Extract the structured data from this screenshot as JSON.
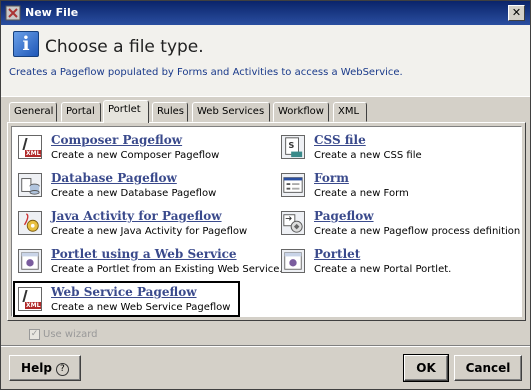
{
  "window": {
    "title": "New File"
  },
  "header": {
    "title": "Choose a file type.",
    "description": "Creates a Pageflow populated by Forms and Activities to access a WebService."
  },
  "tabs": [
    {
      "label": "General"
    },
    {
      "label": "Portal"
    },
    {
      "label": "Portlet",
      "active": true
    },
    {
      "label": "Rules"
    },
    {
      "label": "Web Services"
    },
    {
      "label": "Workflow"
    },
    {
      "label": "XML"
    }
  ],
  "items": {
    "composer": {
      "title": "Composer Pageflow",
      "desc": "Create a new Composer Pageflow",
      "icon": "xml-file-icon"
    },
    "database": {
      "title": "Database Pageflow",
      "desc": "Create a new Database Pageflow",
      "icon": "database-pageflow-icon"
    },
    "java": {
      "title": "Java Activity for Pageflow",
      "desc": "Create a new Java Activity for Pageflow",
      "icon": "java-activity-icon"
    },
    "portlet_ws": {
      "title": "Portlet using a Web Service",
      "desc": "Create a Portlet from an Existing Web Service.",
      "icon": "portlet-ws-icon"
    },
    "web_service": {
      "title": "Web Service Pageflow",
      "desc": "Create a new Web Service Pageflow",
      "icon": "xml-file-icon",
      "selected": true
    },
    "css": {
      "title": "CSS file",
      "desc": "Create a new CSS file",
      "icon": "css-file-icon"
    },
    "form": {
      "title": "Form",
      "desc": "Create a new Form",
      "icon": "form-icon"
    },
    "pageflow": {
      "title": "Pageflow",
      "desc": "Create a new Pageflow process definition",
      "icon": "pageflow-icon"
    },
    "portlet": {
      "title": "Portlet",
      "desc": "Create a new Portal Portlet.",
      "icon": "portlet-icon"
    }
  },
  "use_wizard": {
    "label": "Use wizard",
    "checked": true,
    "enabled": false
  },
  "buttons": {
    "help": "Help",
    "ok": "OK",
    "cancel": "Cancel"
  }
}
